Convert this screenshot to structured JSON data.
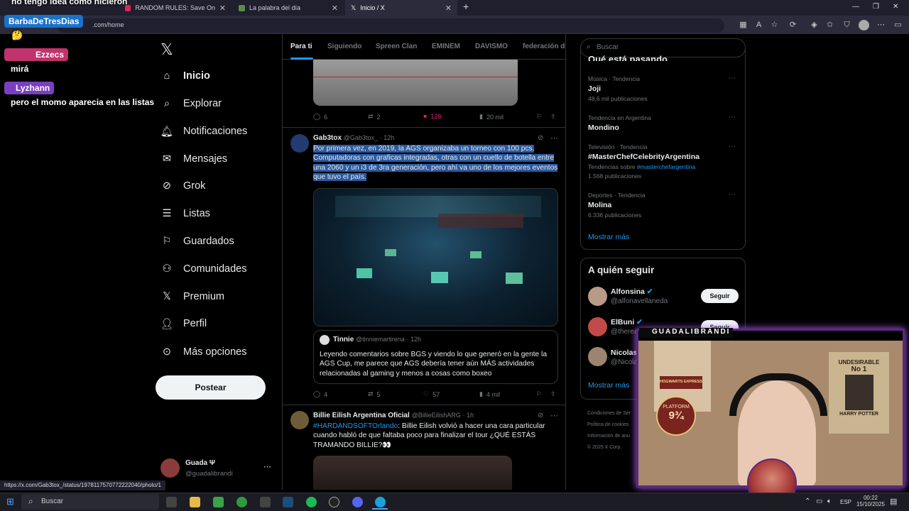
{
  "browser": {
    "tabs": [
      {
        "title": "RANDOM RULES: Save One Song -",
        "active": false
      },
      {
        "title": "La palabra del día",
        "active": false
      },
      {
        "title": "Inicio / X",
        "active": true
      }
    ],
    "address": ".com/home",
    "new_tab_icon": "plus-icon"
  },
  "overlay_chat": {
    "top_line": "no tengo idea como hicieron",
    "messages": [
      {
        "user": "BarbaDeTresDias",
        "text": "🤔"
      },
      {
        "user": "Ezzecs",
        "text": "mirá"
      },
      {
        "user": "Lyzhann",
        "text": "pero el momo aparecia en las listas"
      }
    ]
  },
  "nav": {
    "items": [
      "Inicio",
      "Explorar",
      "Notificaciones",
      "Mensajes",
      "Grok",
      "Listas",
      "Guardados",
      "Comunidades",
      "Premium",
      "Perfil",
      "Más opciones"
    ],
    "post_label": "Postear",
    "account_name": "Guada Ψ",
    "account_handle": "@guadalibrandi"
  },
  "feed": {
    "tabs": [
      "Para ti",
      "Siguiendo",
      "Spreen Clan",
      "EMINEM",
      "DAVISMO",
      "federación de"
    ],
    "prev_actions": {
      "replies": "6",
      "reposts": "2",
      "likes": "126",
      "views": "20 mil"
    },
    "tweet1": {
      "name": "Gab3tox",
      "handle": "@Gab3tox_",
      "time": "· 12h",
      "lines": [
        "Por primera vez, en 2019, la AGS organizaba un torneo con 100 pcs.",
        "Computadoras con graficas integradas, otras con un cuello de botella entre",
        "una 2060 y un i3 de 3ra generación, pero ahí va uno de los mejores eventos",
        "que tuvo el país."
      ],
      "quote": {
        "name": "Tinnie",
        "handle": "@tinniemartirena",
        "time": "· 12h",
        "lines": [
          "Leyendo comentarios sobre BGS y viendo lo que generó en la gente la",
          "AGS Cup, me parece que AGS debería tener aún MÁS actividades",
          "relacionadas al gaming y menos a cosas como boxeo"
        ]
      },
      "actions": {
        "replies": "4",
        "reposts": "5",
        "likes": "57",
        "views": "4 mil"
      }
    },
    "tweet2": {
      "name": "Billie Eilish Argentina Oficial",
      "handle": "@BillieEilishARG",
      "time": "· 1h",
      "hashtag": "#HARDANDSOFTOrlando",
      "line1_rest": ": Billie Eilish volvió a hacer una cara particular",
      "line2": "cuando habló de que faltaba poco para finalizar el tour ¿QUÉ ESTÁS",
      "line3": "TRAMANDO BILLIE?👀"
    }
  },
  "sidebar": {
    "search_placeholder": "Buscar",
    "trends_title": "Qué está pasando",
    "trends": [
      {
        "cat": "Música · Tendencia",
        "name": "Joji",
        "count": "48,6 mil publicaciones"
      },
      {
        "cat": "Tendencia en Argentina",
        "name": "Mondino",
        "count": ""
      },
      {
        "cat": "Televisión · Tendencia",
        "name": "#MasterChefCelebrityArgentina",
        "count": "1.568 publicaciones",
        "related_prefix": "Tendencias sobre",
        "related_tag": "#masterchefargentina"
      },
      {
        "cat": "Deportes · Tendencia",
        "name": "Molina",
        "count": "6.336 publicaciones"
      }
    ],
    "show_more": "Mostrar más",
    "follow_title": "A quién seguir",
    "follow": [
      {
        "name": "Alfonsina",
        "handle": "@alfonavellaneda",
        "btn": "Seguir"
      },
      {
        "name": "ElBuni",
        "handle": "@therea",
        "btn": "Seguir"
      },
      {
        "name": "Nicolas D",
        "handle": "@Nicola",
        "btn": "Seguir"
      }
    ],
    "follow_more": "Mostrar más",
    "footer": [
      "Condiciones de Ser",
      "Política de cookies",
      "Información de anu",
      "© 2025 X Corp."
    ]
  },
  "webcam": {
    "label": "GUADALIBRANDI",
    "poster1_top": "UNDESIRABLE",
    "poster1_sub": "No 1",
    "poster1_name": "HARRY POTTER",
    "sign1": "HOGWARTS EXPRESS",
    "sign2": "PLATFORM",
    "sign2_num": "9¾"
  },
  "status_url": "https://x.com/Gab3tox_/status/1978117570772222040/photo/1",
  "taskbar": {
    "search": "Buscar",
    "lang": "ESP",
    "time": "00:22",
    "date": "15/10/2025"
  },
  "colors": {
    "accent": "#1d9bf0",
    "like": "#f91880",
    "bg": "#000000"
  }
}
